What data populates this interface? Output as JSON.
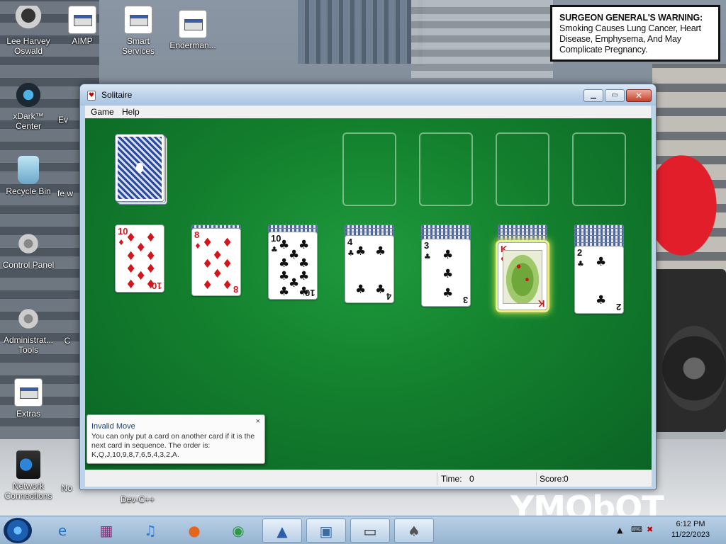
{
  "desktop": {
    "icons": [
      {
        "label": "Lee Harvey Oswald"
      },
      {
        "label": "AIMP"
      },
      {
        "label": "Smart Services"
      },
      {
        "label": "Enderman..."
      },
      {
        "label": "xDark™ Center"
      },
      {
        "label": "Ev"
      },
      {
        "label": "Recycle Bin"
      },
      {
        "label": "fe w"
      },
      {
        "label": "Control Panel"
      },
      {
        "label": "Administrat... Tools"
      },
      {
        "label": "C"
      },
      {
        "label": "Extras"
      },
      {
        "label": "Network Connections"
      },
      {
        "label": "No"
      },
      {
        "label": "Dev-C++"
      }
    ],
    "warning_bold": "SURGEON GENERAL'S WARNING:",
    "warning_text": "Smoking Causes Lung Cancer, Heart Disease, Emphysema, And May Complicate Pregnancy.",
    "wallpaper_text": "YMObOT"
  },
  "window": {
    "title": "Solitaire",
    "menu": {
      "game": "Game",
      "help": "Help"
    },
    "status": {
      "time_label": "Time:",
      "time_value": "0",
      "score_label": "Score:",
      "score_value": "0"
    }
  },
  "tableau": [
    {
      "rank": "10",
      "suit": "♦",
      "color": "#d4151c",
      "hidden": 0
    },
    {
      "rank": "8",
      "suit": "♦",
      "color": "#d4151c",
      "hidden": 1
    },
    {
      "rank": "10",
      "suit": "♣",
      "color": "#111111",
      "hidden": 2
    },
    {
      "rank": "4",
      "suit": "♣",
      "color": "#111111",
      "hidden": 3
    },
    {
      "rank": "3",
      "suit": "♣",
      "color": "#111111",
      "hidden": 4
    },
    {
      "rank": "K",
      "suit": "♥",
      "color": "#d4151c",
      "hidden": 5,
      "selected": true
    },
    {
      "rank": "2",
      "suit": "♣",
      "color": "#111111",
      "hidden": 6
    }
  ],
  "toast": {
    "title": "Invalid Move",
    "message": "You can only put a card on another card if it is the next card in sequence. The order is: K,Q,J,10,9,8,7,6,5,4,3,2,A.",
    "close": "×"
  },
  "taskbar": {
    "items": [
      "internet-explorer",
      "winrar",
      "itunes",
      "firefox",
      "chrome",
      "xcode",
      "remote-desktop",
      "laptop",
      "solitaire"
    ],
    "time": "6:12 PM",
    "date": "11/22/2023"
  }
}
